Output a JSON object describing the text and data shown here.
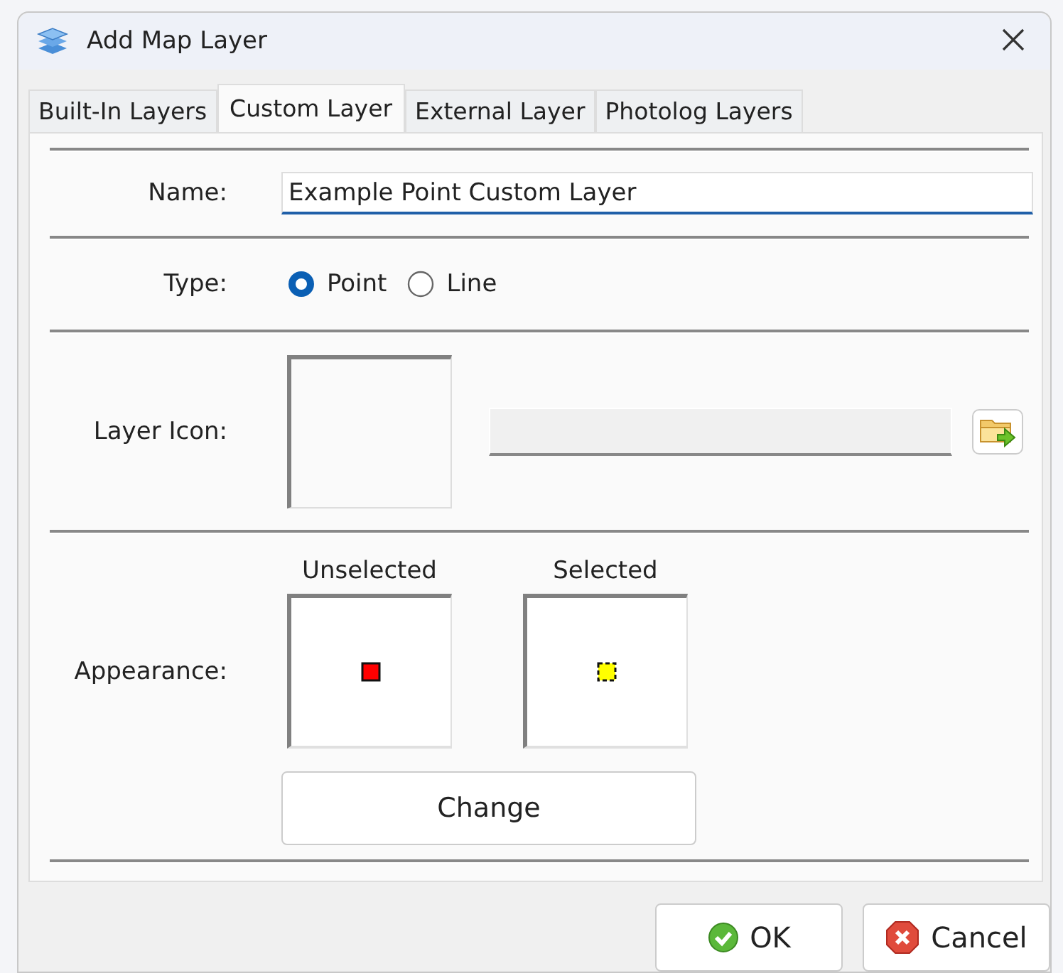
{
  "window": {
    "title": "Add Map Layer"
  },
  "tabs": [
    {
      "label": "Built-In Layers",
      "selected": false
    },
    {
      "label": "Custom Layer",
      "selected": true
    },
    {
      "label": "External Layer",
      "selected": false
    },
    {
      "label": "Photolog Layers",
      "selected": false
    }
  ],
  "name": {
    "label": "Name:",
    "value": "Example Point Custom Layer"
  },
  "type": {
    "label": "Type:",
    "options": [
      {
        "label": "Point",
        "selected": true
      },
      {
        "label": "Line",
        "selected": false
      }
    ]
  },
  "layer_icon": {
    "label": "Layer Icon:"
  },
  "appearance": {
    "label": "Appearance:",
    "previews": [
      {
        "caption": "Unselected",
        "kind": "unselected",
        "color": "#ff0000"
      },
      {
        "caption": "Selected",
        "kind": "selected",
        "color": "#ffff00"
      }
    ],
    "button": "Change"
  },
  "buttons": [
    {
      "label": "OK",
      "kind": "ok"
    },
    {
      "label": "Cancel",
      "kind": "cancel"
    }
  ]
}
